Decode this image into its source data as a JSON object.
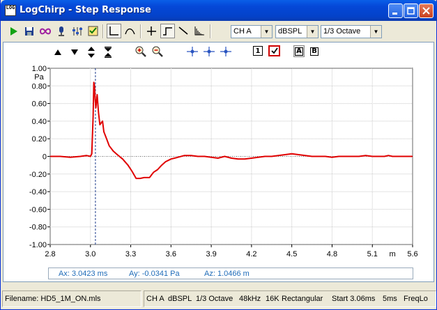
{
  "window": {
    "title": "LogChirp - Step Response",
    "app_icon_text": "LOG"
  },
  "toolbar": {
    "channel": "CH A",
    "units": "dBSPL",
    "smoothing": "1/3 Octave"
  },
  "plot_toolbar": {
    "box1_label": "1",
    "box_a_label": "A",
    "box_b_label": "B"
  },
  "chart_data": {
    "type": "line",
    "ylabel": "Pa",
    "xlabel": "m",
    "xlim": [
      2.8,
      5.6
    ],
    "ylim": [
      -1.0,
      1.0
    ],
    "x_ticks": [
      "2.8",
      "3.0",
      "3.3",
      "3.6",
      "3.9",
      "4.2",
      "4.5",
      "4.8",
      "5.1",
      "5.6"
    ],
    "x_tick_values": [
      2.8,
      3.0,
      3.3,
      3.6,
      3.9,
      4.2,
      4.5,
      4.8,
      5.1,
      5.6
    ],
    "x_unit_value": 5.35,
    "y_ticks": [
      "1.00",
      "0.80",
      "0.60",
      "0.40",
      "0.20",
      "0",
      "-0.20",
      "-0.40",
      "-0.60",
      "-0.80",
      "-1.00"
    ],
    "y_tick_values": [
      1.0,
      0.8,
      0.6,
      0.4,
      0.2,
      0,
      -0.2,
      -0.4,
      -0.6,
      -0.8,
      -1.0
    ],
    "cursor_x": 3.0423,
    "grid": true,
    "series": [
      {
        "color": "#E00000",
        "x": [
          2.8,
          2.85,
          2.9,
          2.95,
          2.98,
          3.0,
          3.01,
          3.02,
          3.025,
          3.03,
          3.035,
          3.04,
          3.05,
          3.06,
          3.07,
          3.08,
          3.09,
          3.1,
          3.12,
          3.14,
          3.17,
          3.2,
          3.24,
          3.28,
          3.31,
          3.34,
          3.37,
          3.4,
          3.44,
          3.47,
          3.5,
          3.53,
          3.56,
          3.6,
          3.65,
          3.7,
          3.75,
          3.8,
          3.85,
          3.9,
          3.95,
          4.0,
          4.05,
          4.1,
          4.15,
          4.2,
          4.25,
          4.3,
          4.35,
          4.4,
          4.45,
          4.5,
          4.55,
          4.6,
          4.65,
          4.7,
          4.75,
          4.8,
          4.85,
          4.9,
          4.95,
          5.0,
          5.05,
          5.1,
          5.15,
          5.2,
          5.25,
          5.3,
          5.35,
          5.4,
          5.45,
          5.5,
          5.55,
          5.6
        ],
        "y": [
          0.0,
          0.0,
          -0.01,
          0.0,
          0.01,
          0.0,
          0.03,
          0.45,
          0.84,
          0.8,
          0.65,
          0.55,
          0.7,
          0.5,
          0.36,
          0.38,
          0.4,
          0.28,
          0.2,
          0.12,
          0.06,
          0.02,
          -0.03,
          -0.1,
          -0.17,
          -0.25,
          -0.25,
          -0.24,
          -0.24,
          -0.18,
          -0.15,
          -0.1,
          -0.06,
          -0.03,
          -0.01,
          0.01,
          0.01,
          0.0,
          0.0,
          -0.01,
          -0.02,
          0.0,
          -0.02,
          -0.03,
          -0.03,
          -0.02,
          -0.01,
          0.0,
          0.0,
          0.01,
          0.02,
          0.03,
          0.02,
          0.01,
          0.0,
          0.0,
          0.0,
          -0.01,
          0.0,
          0.0,
          0.0,
          0.0,
          0.01,
          0.0,
          0.0,
          0.0,
          0.0,
          0.01,
          0.0,
          0.0,
          0.0,
          0.0,
          0.0,
          0.0
        ]
      }
    ]
  },
  "readout": {
    "ax": "Ax: 3.0423 ms",
    "ay": "Ay: -0.0341 Pa",
    "az": "Az: 1.0466 m"
  },
  "status": {
    "filename": "Filename: HD5_1M_ON.mls",
    "channel": "CH A",
    "units": "dBSPL",
    "smoothing": "1/3 Octave",
    "rate": "48kHz",
    "length": "16K",
    "window": "Rectangular",
    "start": "Start 3.06ms",
    "width": "5ms",
    "freq": "FreqLo"
  },
  "colors": {
    "accent": "#0A5FE8",
    "trace": "#E00000",
    "cursor": "#1E3C8C",
    "readout_text": "#1E6BB8"
  }
}
